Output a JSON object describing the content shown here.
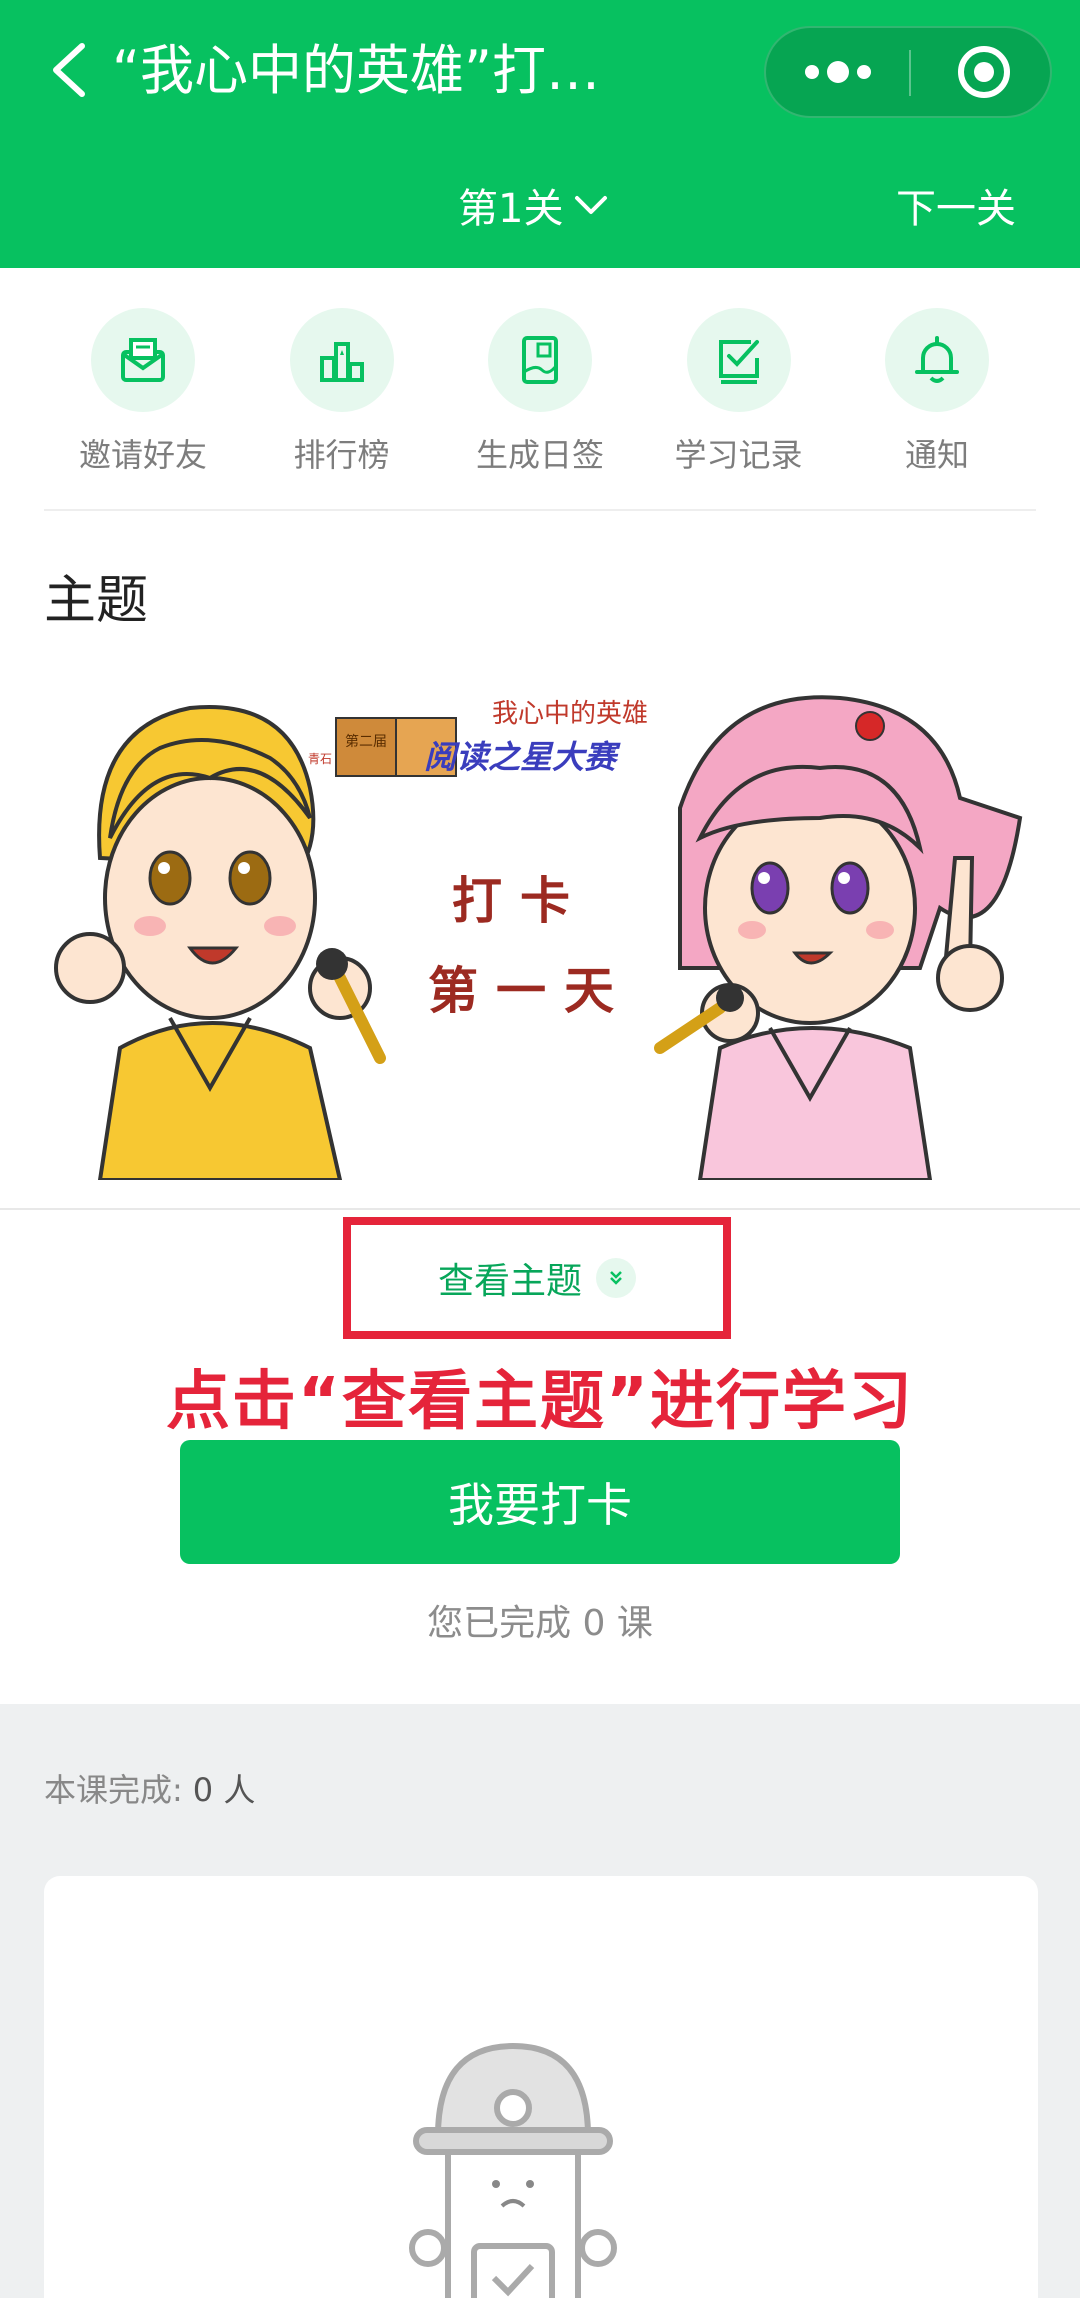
{
  "header": {
    "title": "“我心中的英雄”打…",
    "level": "第1关",
    "next_level": "下一关",
    "icons": [
      "back-arrow-icon",
      "more-dots-icon",
      "target-close-icon",
      "chevron-down-icon"
    ]
  },
  "toolbar": {
    "items": [
      {
        "label": "邀请好友",
        "icon": "invite-envelope-icon"
      },
      {
        "label": "排行榜",
        "icon": "ranking-bars-icon"
      },
      {
        "label": "生成日签",
        "icon": "daily-sign-icon"
      },
      {
        "label": "学习记录",
        "icon": "study-record-icon"
      },
      {
        "label": "通知",
        "icon": "bell-icon"
      }
    ]
  },
  "theme": {
    "heading": "主题",
    "banner": {
      "subtitle": "我心中的英雄",
      "book_small": "第二届",
      "book_side": "青石",
      "book_title": "阅读之星大赛",
      "line1": "打卡",
      "line2": "第一天"
    },
    "view_label": "查看主题"
  },
  "instruction": "点击“查看主题”进行学习",
  "checkin_label": "我要打卡",
  "completed_text": "您已完成 0 课",
  "lesson_finished": {
    "label": "本课完成:",
    "value": "0 人"
  },
  "colors": {
    "brand_green": "#07c160",
    "highlight_red": "#e5243a",
    "icon_bg": "#e6f8ee"
  }
}
